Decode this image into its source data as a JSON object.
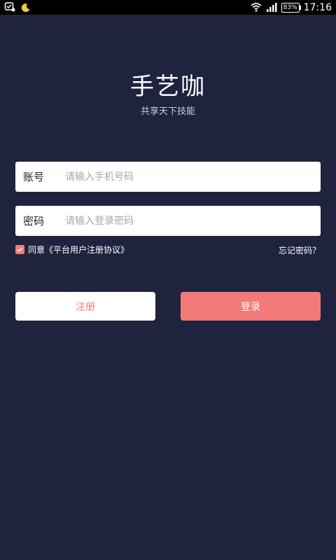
{
  "status_bar": {
    "left_icons": [
      "notification-icon",
      "moon-icon"
    ],
    "right_icons": [
      "wifi-icon",
      "signal-icon"
    ],
    "battery": "83%",
    "time": "17:16"
  },
  "app": {
    "title": "手艺咖",
    "subtitle": "共享天下技能"
  },
  "form": {
    "account": {
      "label": "账号",
      "placeholder": "请输入手机号码",
      "value": ""
    },
    "password": {
      "label": "密码",
      "placeholder": "请输入登录密码",
      "value": ""
    },
    "agreement": {
      "checked": true,
      "text": "同意《平台用户注册协议》"
    },
    "forgot_password": "忘记密码？"
  },
  "buttons": {
    "register": "注册",
    "login": "登录"
  },
  "colors": {
    "background": "#20233e",
    "accent": "#f47a79",
    "status_bar": "#000000"
  }
}
